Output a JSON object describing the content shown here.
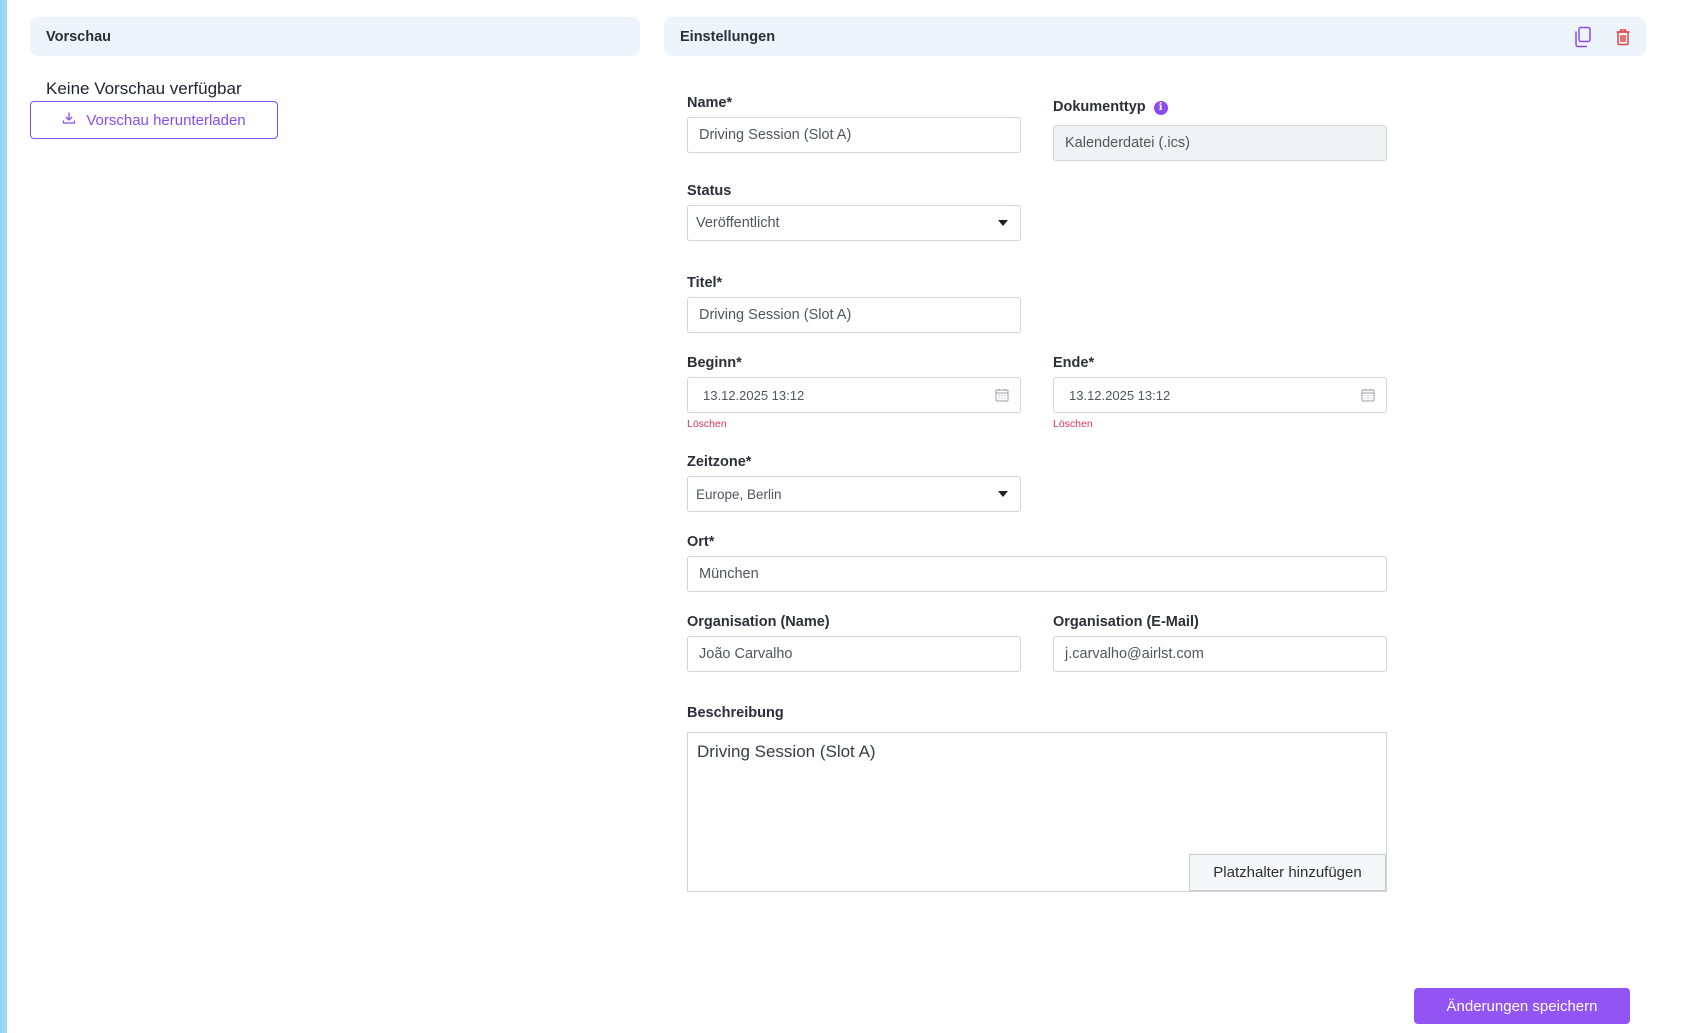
{
  "preview": {
    "title": "Vorschau",
    "no_preview_text": "Keine Vorschau verfügbar",
    "download_label": "Vorschau herunterladen"
  },
  "settings": {
    "title": "Einstellungen",
    "copy_icon": "copy-icon",
    "delete_icon": "trash-icon"
  },
  "form": {
    "name": {
      "label": "Name*",
      "value": "Driving Session (Slot A)"
    },
    "doctype": {
      "label": "Dokumenttyp",
      "value": "Kalenderdatei (.ics)",
      "info_glyph": "i"
    },
    "status": {
      "label": "Status",
      "value": "Veröffentlicht"
    },
    "titel": {
      "label": "Titel*",
      "value": "Driving Session (Slot A)"
    },
    "beginn": {
      "label": "Beginn*",
      "value": "13.12.2025 13:12",
      "clear": "Löschen"
    },
    "ende": {
      "label": "Ende*",
      "value": "13.12.2025 13:12",
      "clear": "Löschen"
    },
    "zeitzone": {
      "label": "Zeitzone*",
      "value": "Europe, Berlin"
    },
    "ort": {
      "label": "Ort*",
      "value": "München"
    },
    "org_name": {
      "label": "Organisation (Name)",
      "value": "João Carvalho"
    },
    "org_email": {
      "label": "Organisation (E-Mail)",
      "value": "j.carvalho@airlst.com"
    },
    "beschreibung": {
      "label": "Beschreibung",
      "value": "Driving Session (Slot A)",
      "placeholder_button": "Platzhalter hinzufügen"
    }
  },
  "actions": {
    "save_label": "Änderungen speichern"
  },
  "colors": {
    "accent": "#9254f3",
    "danger": "#d9365d",
    "header_bg": "#eef4fc"
  }
}
